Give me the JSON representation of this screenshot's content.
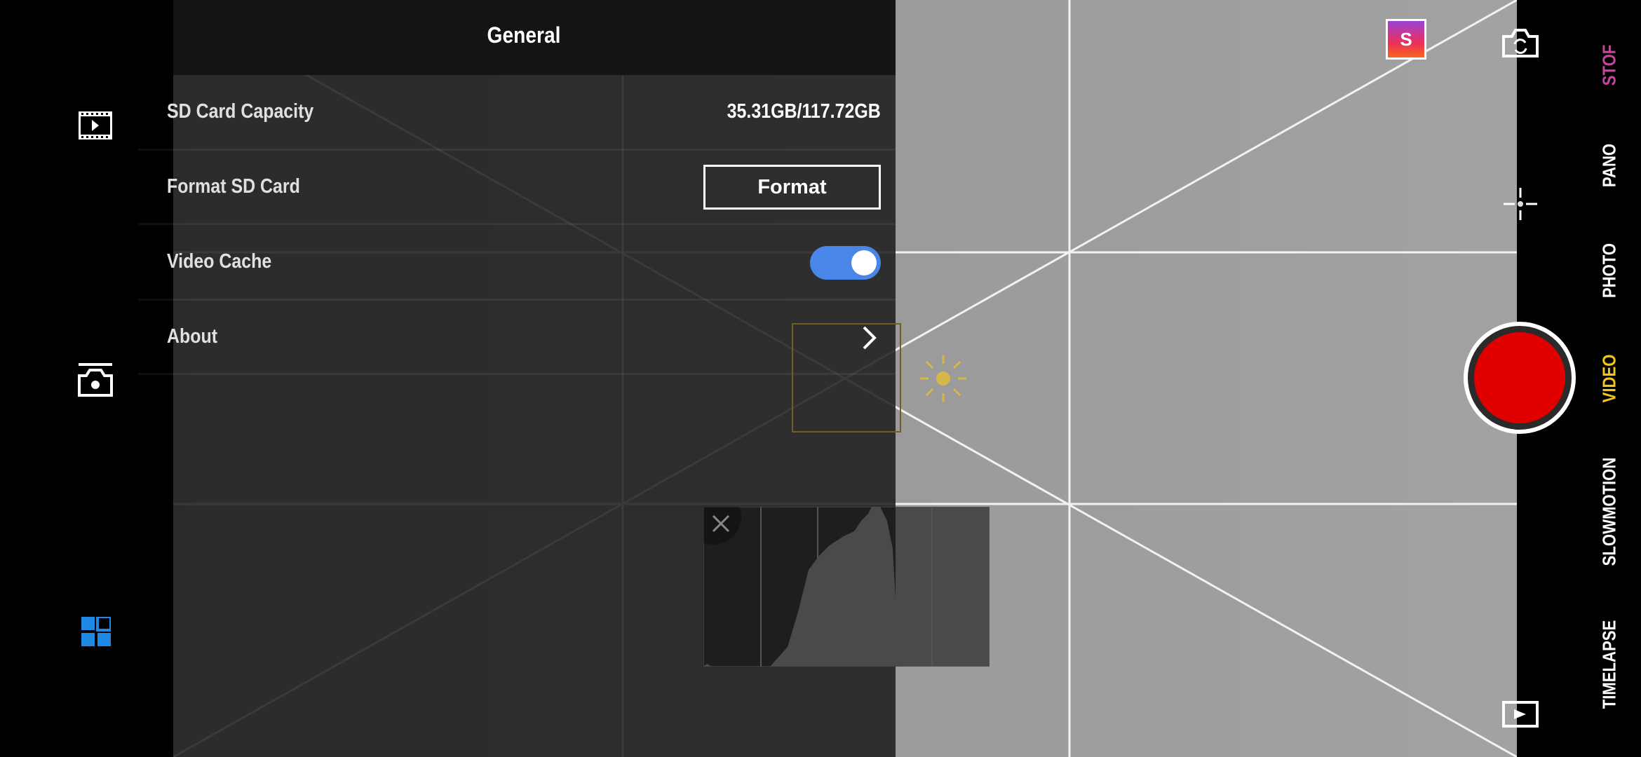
{
  "panel": {
    "title": "General",
    "rows": [
      {
        "label": "SD Card Capacity",
        "value": "35.31GB/117.72GB"
      },
      {
        "label": "Format SD Card",
        "button": "Format"
      },
      {
        "label": "Video Cache",
        "toggle_on": true
      },
      {
        "label": "About"
      }
    ]
  },
  "badge": {
    "letter": "S"
  },
  "modes": [
    {
      "label": "STOF",
      "color": "#c2469a"
    },
    {
      "label": "PANO",
      "color": "#ffffff"
    },
    {
      "label": "PHOTO",
      "color": "#ffffff"
    },
    {
      "label": "VIDEO",
      "color": "#f5c518",
      "selected": true
    },
    {
      "label": "SLOWMOTION",
      "color": "#ffffff"
    },
    {
      "label": "TIMELAPSE",
      "color": "#ffffff"
    }
  ],
  "colors": {
    "accent": "#4a86e8",
    "record": "#e00000",
    "exposure": "#d6b84a"
  },
  "icons": [
    "film-icon",
    "camera-icon",
    "grid-apps-icon",
    "switch-camera-icon",
    "focus-icon",
    "play-icon",
    "sun-icon",
    "close-icon",
    "chevron-right-icon"
  ]
}
